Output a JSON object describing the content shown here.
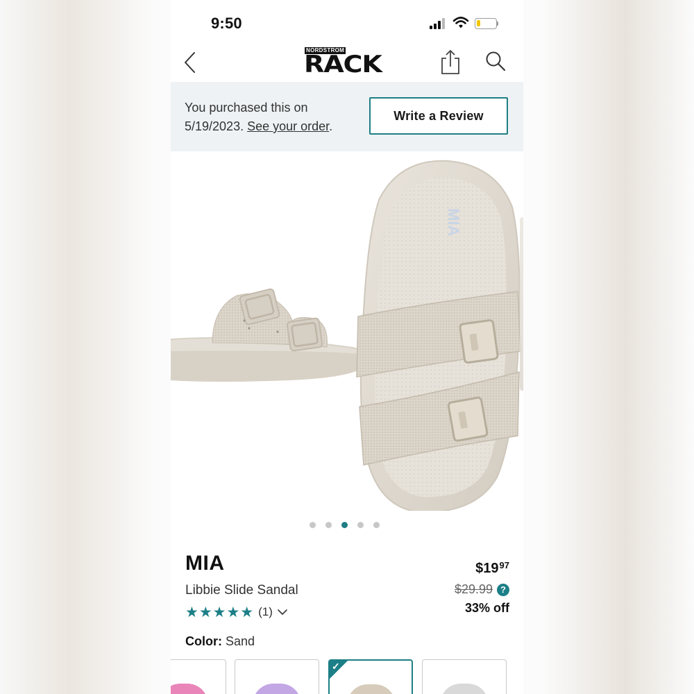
{
  "status_bar": {
    "time": "9:50",
    "battery_level": 0.2,
    "battery_color": "#f2c400"
  },
  "nav": {
    "logo_top": "NORDSTROM",
    "logo_main": "RACK",
    "back_icon": "chevron-left-icon",
    "share_icon": "share-icon",
    "search_icon": "search-icon"
  },
  "purchase_banner": {
    "line1": "You purchased this on",
    "date": "5/19/2023.",
    "order_link": "See your order",
    "link_suffix": ".",
    "review_button": "Write a Review",
    "accent_color": "#1e7f83"
  },
  "gallery": {
    "active_index": 2,
    "total_images": 5,
    "image_text": "MIA"
  },
  "product": {
    "brand": "MIA",
    "name": "Libbie Slide Sandal",
    "stars": "★★★★★",
    "rating": 5,
    "review_count": "(1)",
    "price_dollars": "$19",
    "price_cents": "97",
    "original_price": "$29.99",
    "help_glyph": "?",
    "discount": "33% off",
    "color_label": "Color:",
    "color_value": "Sand"
  },
  "swatches": {
    "colors": [
      "#e985b9",
      "#c3a6e4",
      "#d7ccbb",
      "#d9d9d9"
    ],
    "selected_index": 2,
    "check_glyph": "✓"
  }
}
